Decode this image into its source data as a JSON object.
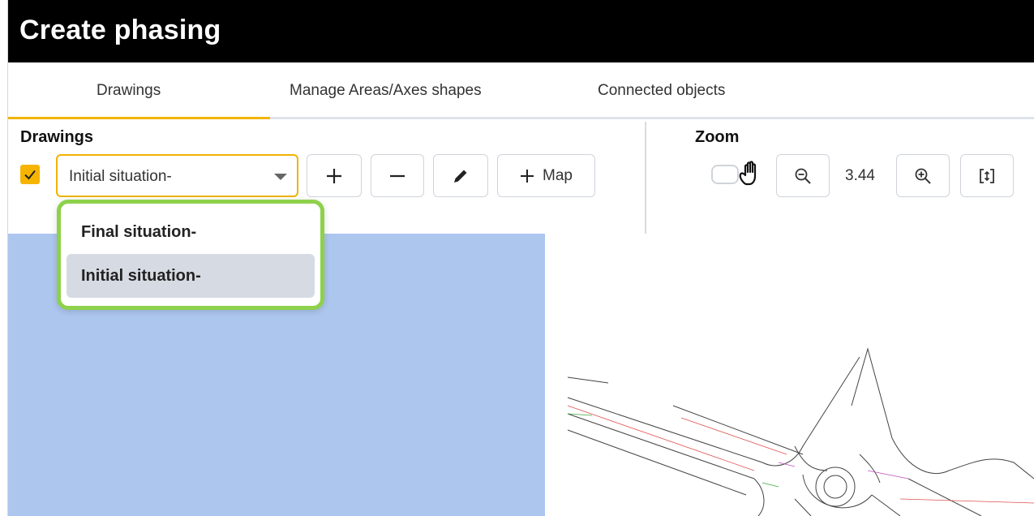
{
  "window": {
    "title": "Create phasing"
  },
  "tabs": [
    {
      "label": "Drawings",
      "active": true
    },
    {
      "label": "Manage Areas/Axes shapes",
      "active": false
    },
    {
      "label": "Connected objects",
      "active": false
    }
  ],
  "drawings": {
    "section_label": "Drawings",
    "checked": true,
    "selected_value": "Initial situation-",
    "buttons": {
      "add_icon": "plus-icon",
      "remove_icon": "minus-icon",
      "edit_icon": "pencil-icon",
      "map_label": "Map"
    },
    "options": [
      {
        "label": "Final situation-",
        "selected": false
      },
      {
        "label": "Initial situation-",
        "selected": true
      }
    ]
  },
  "zoom": {
    "section_label": "Zoom",
    "pan_toggle_on": false,
    "value": "3.44",
    "icons": [
      "hand-icon",
      "zoom-out-icon",
      "zoom-in-icon",
      "fit-height-icon"
    ]
  },
  "colors": {
    "accent": "#f4b400",
    "dropdown_highlight": "#8ed14b",
    "map_area": "#adc6ee",
    "titlebar": "#000000"
  }
}
